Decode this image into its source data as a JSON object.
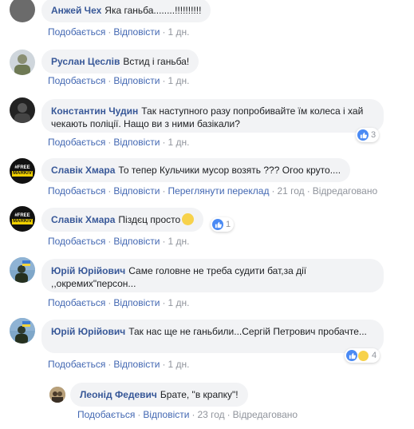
{
  "comments": [
    {
      "author": "Анжей Чех",
      "text": "Яка ганьба........!!!!!!!!!!",
      "like": "Подобається",
      "reply": "Відповісти",
      "time": "1 дн."
    },
    {
      "author": "Руслан Цеслів",
      "text": "Встид і ганьба!",
      "like": "Подобається",
      "reply": "Відповісти",
      "time": "1 дн."
    },
    {
      "author": "Константин Чудин",
      "text": "Так наступного разу попробивайте їм колеса і хай чекають поліції. Нащо ви з ними базікали?",
      "like": "Подобається",
      "reply": "Відповісти",
      "time": "1 дн.",
      "reaction_count": "3"
    },
    {
      "author": "Славік Хмара",
      "text": "То тепер Кульчики мусор возять ??? Огоо круто....",
      "like": "Подобається",
      "reply": "Відповісти",
      "translate": "Переглянути переклад",
      "time": "21 год",
      "edited": "Відредаговано",
      "avatar_text_1": "#FREE",
      "avatar_text_2": "MARKIV"
    },
    {
      "author": "Славік Хмара",
      "text": "Піздєц просто",
      "like": "Подобається",
      "reply": "Відповісти",
      "time": "1 дн.",
      "reaction_count": "1",
      "avatar_text_1": "#FREE",
      "avatar_text_2": "MARKIV"
    },
    {
      "author": "Юрій Юрійович",
      "text": "Саме головне не треба судити бат,за дії ,,окремих\"персон...",
      "like": "Подобається",
      "reply": "Відповісти",
      "time": "1 дн."
    },
    {
      "author": "Юрій Юрійович",
      "text": "Так нас ще не ганьбили...Сергій Петрович пробачте...",
      "like": "Подобається",
      "reply": "Відповісти",
      "time": "1 дн.",
      "reaction_count": "4"
    },
    {
      "author": "Леонід Федевич",
      "text": "Брате, \"в крапку\"!",
      "like": "Подобається",
      "reply": "Відповісти",
      "time": "23 год",
      "edited": "Відредаговано"
    }
  ],
  "colors": {
    "link": "#4267b2",
    "author": "#385898",
    "bubble": "#f2f3f5",
    "meta": "#90949c"
  }
}
